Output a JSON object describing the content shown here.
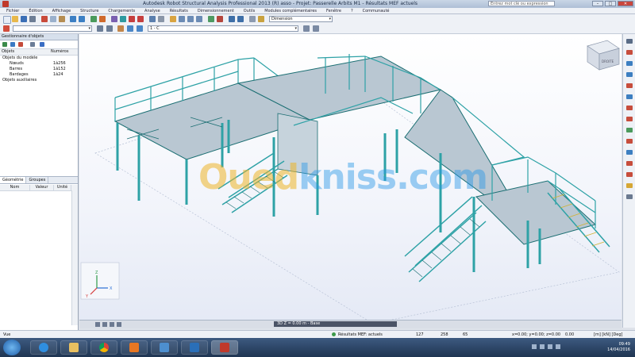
{
  "window": {
    "title": "Autodesk Robot Structural Analysis Professional 2013 (R) asso - Projet: Passerelle Arbits M1 - Résultats MEF actuels",
    "search_placeholder": "Entrez mot clé ou expression",
    "minimize": "–",
    "maximize": "□",
    "close": "✕"
  },
  "menu": [
    "Fichier",
    "Édition",
    "Affichage",
    "Structure",
    "Chargements",
    "Analyse",
    "Résultats",
    "Dimensionnement",
    "Outils",
    "Modules complémentaires",
    "Fenêtre",
    "?",
    "Communauté"
  ],
  "toolbar": {
    "combo_filter": "",
    "combo_section": "1 - C",
    "combo_view": "Dimension"
  },
  "object_panel": {
    "title": "Gestionnaire d'objets",
    "columns": [
      "Objets",
      "Numéros"
    ],
    "rows": [
      {
        "name": "Objets du modèle",
        "num": ""
      },
      {
        "name": "Nœuds",
        "num": "1à256"
      },
      {
        "name": "Barres",
        "num": "1à152"
      },
      {
        "name": "Bardages",
        "num": "1à24"
      },
      {
        "name": "Objets auxiliaires",
        "num": ""
      }
    ],
    "tabs": [
      "Géométrie",
      "Groupes"
    ],
    "prop_columns": [
      "Nom",
      "Valeur",
      "Unité"
    ]
  },
  "viewport": {
    "watermark_part1": "Oued",
    "watermark_part2": "kniss.com",
    "axis_labels": {
      "x": "X",
      "y": "Y",
      "z": "Z"
    },
    "view_cube_label": "DROITE",
    "bottom_tab": "3D   Z = 0.00 m - Base"
  },
  "status": {
    "left": "Vue",
    "results": "Résultats MEF: actuels",
    "nodes": "127",
    "bars": "258",
    "sections": "65",
    "coords": "x=0.00; y=0.00; z=0.00",
    "units": "0.00",
    "unit_system": "[m] [kN] [Deg]"
  },
  "taskbar": {
    "time": "09:49",
    "date": "14/04/2016"
  },
  "colors": {
    "structure": "#2ea2a6",
    "structure_dark": "#1a6e72",
    "deck": "#b8c6d1",
    "grid_line": "#bcc6d8",
    "taskbar": "#2c4669"
  }
}
